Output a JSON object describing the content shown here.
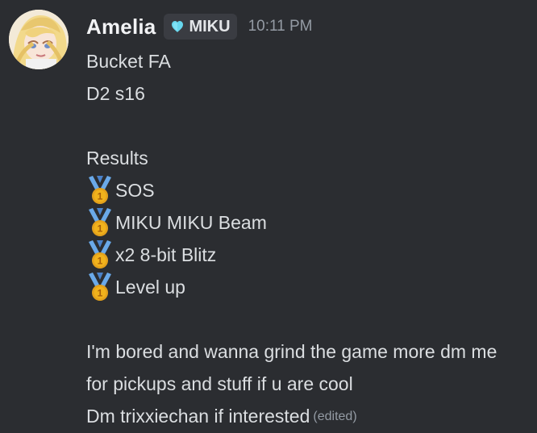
{
  "user": {
    "name": "Amelia",
    "tag": "MIKU",
    "tag_icon": "heart-icon",
    "time": "10:11 PM"
  },
  "message": {
    "line1": "Bucket FA",
    "line2": "D2 s16",
    "results_title": "Results",
    "results": [
      "SOS",
      "MIKU MIKU Beam",
      "x2 8-bit Blitz",
      "Level up"
    ],
    "result_icon": "first-place-medal-icon",
    "para1": "I'm bored and wanna grind the game more dm me",
    "para2": "for pickups and stuff if u are cool",
    "para3": "Dm trixxiechan if interested",
    "edited": "(edited)"
  },
  "colors": {
    "background": "#2b2d31",
    "text": "#dbdee1",
    "username": "#f2f3f5",
    "muted": "#949ba4",
    "tag_bg": "#3a3c42",
    "medal_gold": "#e4a11b",
    "medal_ribbon": "#6aa9e9"
  }
}
